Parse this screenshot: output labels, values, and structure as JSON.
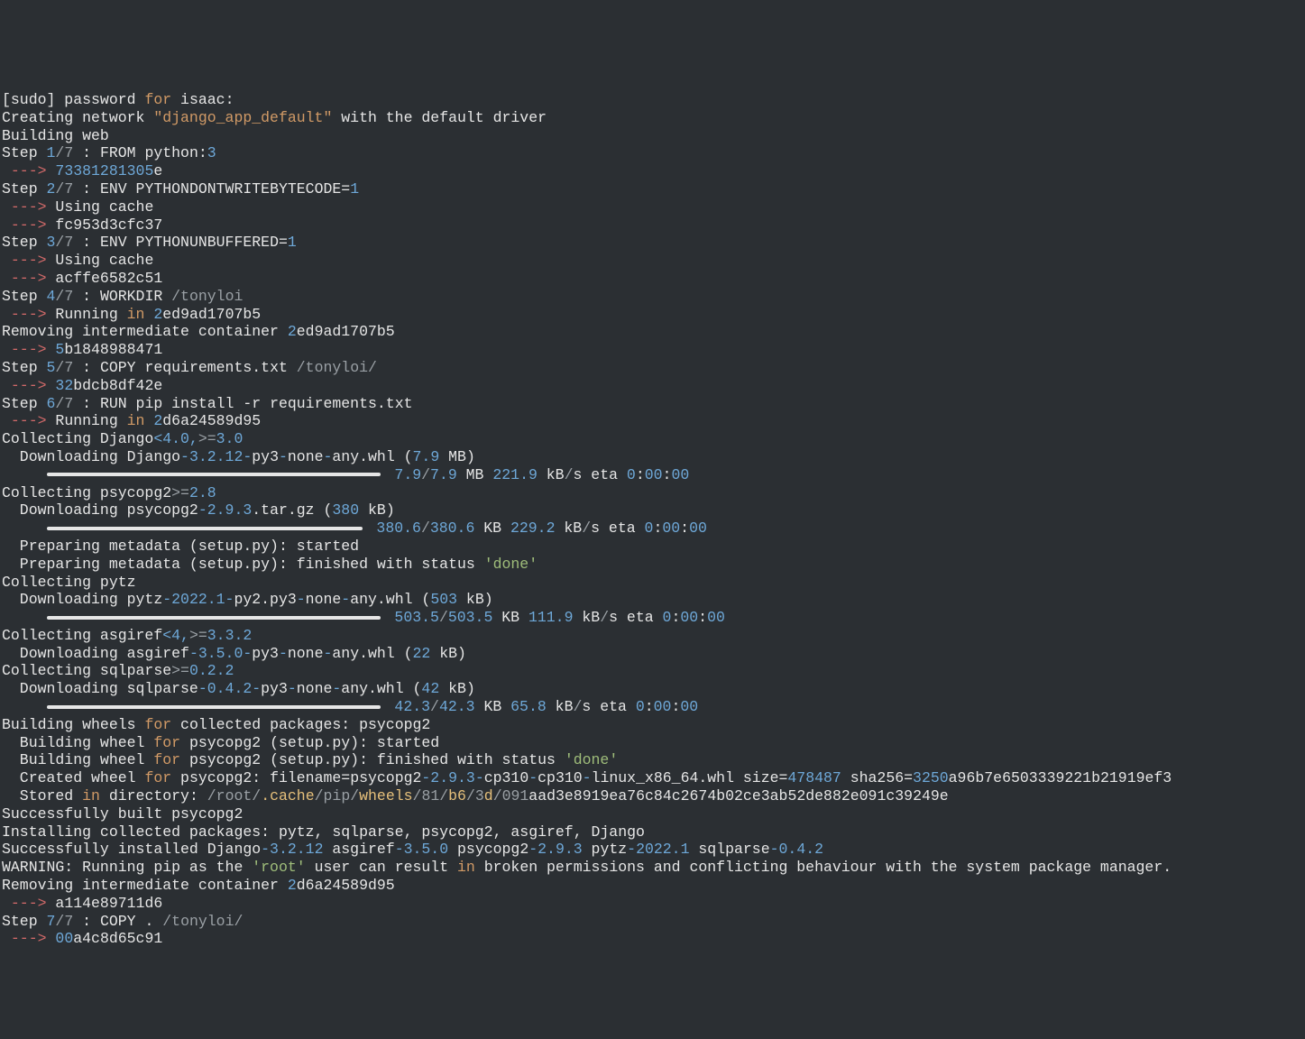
{
  "sudo": {
    "prefix": "[sudo] password ",
    "for": "for",
    "suffix": " isaac:"
  },
  "net": {
    "a": "Creating network ",
    "name": "\"django_app_default\"",
    "b": " with the default driver"
  },
  "bw": "Building web",
  "s1": {
    "step": "Step ",
    "num": "1",
    "total": "/7",
    "cmd": " : FROM python:",
    "tag": "3"
  },
  "arrow": " ---> ",
  "h1a": "73381281305",
  "h1b": "e",
  "s2": {
    "num": "2",
    "cmd": " : ENV PYTHONDONTWRITEBYTECODE=",
    "val": "1"
  },
  "uc": "Using cache",
  "h2": "fc953d3cfc37",
  "s3": {
    "num": "3",
    "cmd": " : ENV PYTHONUNBUFFERED=",
    "val": "1"
  },
  "h3": "acffe6582c51",
  "s4": {
    "num": "4",
    "cmd": " : WORKDIR "
  },
  "path_tonyloi": "/tonyloi",
  "runin": "Running ",
  "in": "in",
  " ": " ",
  "h4a": "2",
  "h4b": "ed9ad1707b5",
  "rmic": "Removing intermediate container ",
  "h5a": "5",
  "h5b": "b1848988471",
  "s5": {
    "num": "5",
    "cmd": " : COPY requirements.txt ",
    "path": "/tonyloi/"
  },
  "h6a": "32",
  "h6b": "bdcb8df42e",
  "s6": {
    "num": "6",
    "cmd": " : RUN pip install -r requirements.txt"
  },
  "h7a": "2",
  "h7b": "d6a24589d95",
  "col_dj": {
    "a": "Collecting Django",
    "b": "<4.0,",
    "c": ">=",
    "d": "3.0"
  },
  "dl_dj": {
    "a": "  Downloading Django",
    "b": "-3.2.12-",
    "c": "py3",
    "d": "-",
    "e": "none",
    "f": "-",
    "g": "any.whl (",
    "h": "7.9",
    "i": " MB)"
  },
  "prog_dj": {
    "cur": "7.9",
    "sl": "/",
    "tot": "7.9",
    "u": " MB ",
    "spd": "221.9",
    "kbs": " kB",
    "per": "/",
    "s": "s eta ",
    "eta": "0:00:00"
  },
  "col_pg": {
    "a": "Collecting psycopg2",
    "b": ">=",
    "c": "2.8"
  },
  "dl_pg": {
    "a": "  Downloading psycopg2",
    "b": "-2.9.3",
    "c": ".tar.gz (",
    "d": "380",
    "e": " kB)"
  },
  "prog_pg": {
    "cur": "380.6",
    "tot": "380.6",
    "u": " KB ",
    "spd": "229.2"
  },
  "meta_s": "  Preparing metadata (setup.py): started",
  "meta_f": {
    "a": "  Preparing metadata (setup.py): finished with status ",
    "done": "'done'"
  },
  "col_tz": "Collecting pytz",
  "dl_tz": {
    "a": "  Downloading pytz",
    "b": "-2022.1-",
    "c": "py2.py3",
    "d": "-",
    "e": "none",
    "f": "-",
    "g": "any.whl (",
    "h": "503",
    "i": " kB)"
  },
  "prog_tz": {
    "cur": "503.5",
    "tot": "503.5",
    "u": " KB ",
    "spd": "111.9"
  },
  "col_as": {
    "a": "Collecting asgiref",
    "b": "<4,",
    "c": ">=",
    "d": "3.3.2"
  },
  "dl_as": {
    "a": "  Downloading asgiref",
    "b": "-3.5.0-",
    "c": "py3",
    "d": "-",
    "e": "none",
    "f": "-",
    "g": "any.whl (",
    "h": "22",
    "i": " kB)"
  },
  "col_sp": {
    "a": "Collecting sqlparse",
    "b": ">=",
    "c": "0.2.2"
  },
  "dl_sp": {
    "a": "  Downloading sqlparse",
    "b": "-0.4.2-",
    "c": "py3",
    "d": "-",
    "e": "none",
    "f": "-",
    "g": "any.whl (",
    "h": "42",
    "i": " kB)"
  },
  "prog_sp": {
    "cur": "42.3",
    "tot": "42.3",
    "u": " KB ",
    "spd": "65.8"
  },
  "bw1": {
    "a": "Building wheels ",
    "for": "for",
    "b": " collected packages: psycopg2"
  },
  "bw2": {
    "a": "  Building wheel ",
    "for": "for",
    "b": " psycopg2 (setup.py): started"
  },
  "bw3": {
    "a": "  Building wheel ",
    "for": "for",
    "b": " psycopg2 (setup.py): finished with status ",
    "done": "'done'"
  },
  "cw": {
    "a": "  Created wheel ",
    "for": "for",
    "b": " psycopg2: filename=psycopg2",
    "c": "-2.9.3-",
    "d": "cp310",
    "e": "-",
    "f": "cp310",
    "g": "-",
    "h": "linux_x86_64.whl size=",
    "sz": "478487",
    "i": " sha256=",
    "sha1": "3250",
    "sha2": "a96b7e6503339221b21919ef3"
  },
  "stored": {
    "a": "  Stored ",
    "in": "in",
    "b": " directory: ",
    "p0": "/root/",
    "p1": ".cache",
    "p2": "/pip/",
    "p3": "wheels",
    "p4": "/81/",
    "p5": "b6",
    "p6": "/3",
    "p7": "d",
    "p8": "/091",
    "p9": "aad3e8919ea76c84c2674b02ce3ab52de882e091c39249e"
  },
  "sb": "Successfully built psycopg2",
  "inst": "Installing collected packages: pytz, sqlparse, psycopg2, asgiref, Django",
  "si": {
    "a": "Successfully installed Django",
    "b": "-3.2.12",
    "c": " asgiref",
    "d": "-3.5.0",
    "e": " psycopg2",
    "f": "-2.9.3",
    "g": " pytz",
    "h": "-2022.1",
    "i": " sqlparse",
    "j": "-0.4.2"
  },
  "warn": {
    "a": "WARNING: Running pip as the ",
    "root": "'root'",
    "b": " user can result ",
    "in": "in",
    "c": " broken permissions and conflicting behaviour with the system package manager."
  },
  "rmic2": "Removing intermediate container ",
  "h8a": "2",
  "h8b": "d6a24589d95",
  "h9": "a114e89711d6",
  "s7": {
    "num": "7",
    "cmd": " : COPY . ",
    "path": "/tonyloi/"
  },
  "h10a": "00",
  "h10b": "a4c8d65c91"
}
